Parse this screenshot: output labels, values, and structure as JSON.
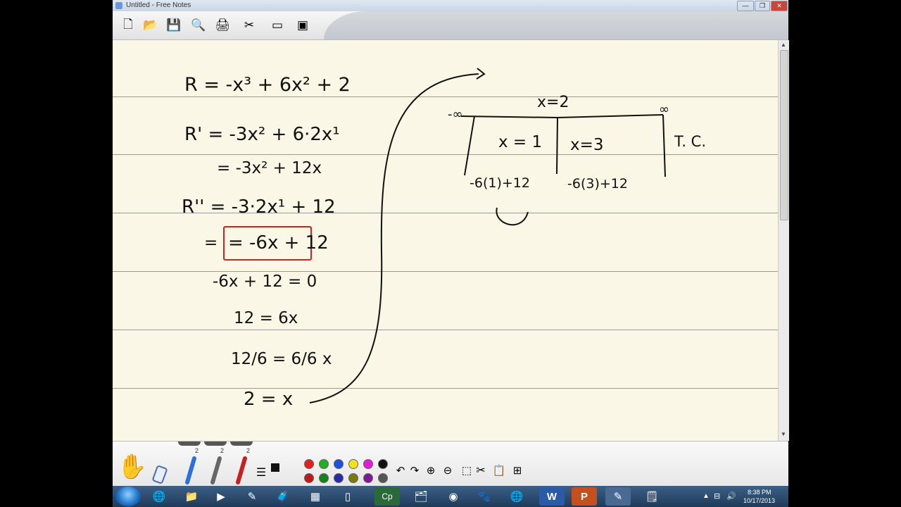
{
  "window": {
    "title": "Untitled - Free Notes",
    "controls": [
      "—",
      "❐",
      "✕"
    ]
  },
  "toolbar": {
    "buttons": [
      {
        "name": "new-file",
        "glyph": "🗋"
      },
      {
        "name": "open-folder",
        "glyph": "📂"
      },
      {
        "name": "save",
        "glyph": "💾"
      },
      {
        "name": "preview",
        "glyph": "🔍"
      },
      {
        "name": "print",
        "glyph": "🖨"
      },
      {
        "name": "capture",
        "glyph": "✂"
      },
      {
        "name": "window",
        "glyph": "▭"
      },
      {
        "name": "export",
        "glyph": "▣"
      }
    ]
  },
  "notes": {
    "left_column": [
      "R = -x³ + 6x² + 2",
      "R' = -3x² + 6·2x¹",
      "= -3x² + 12x",
      "R'' = -3·2x¹ + 12",
      "= -6x + 12",
      "-6x + 12 = 0",
      "12 = 6x",
      "12/6 = 6/6 x",
      "2 = x"
    ],
    "right_section": {
      "critical_point": "x=2",
      "neg_infinity": "-∞",
      "pos_infinity": "∞",
      "intervals": [
        {
          "test": "x = 1",
          "value": "-6(1)+12"
        },
        {
          "test": "x=3",
          "value": "-6(3)+12"
        }
      ],
      "label": "T. C."
    }
  },
  "pen_panel": {
    "pen_numbers": [
      "2",
      "2",
      "2"
    ],
    "colors": {
      "row1": [
        "#e3201b",
        "#20b020",
        "#1d4fe0",
        "#f2e21a",
        "#e21ad9",
        "#111111"
      ],
      "row2": [
        "#c01818",
        "#188018",
        "#2a2aa8",
        "#7a7a10",
        "#7a1a9a",
        "#555555"
      ]
    }
  },
  "taskbar": {
    "apps": [
      "🌐",
      "📁",
      "▶",
      "✎",
      "🧳",
      "▦",
      "▯",
      "Cp",
      "🗂",
      "◉",
      "🐾",
      "🌐",
      "W",
      "P",
      "✎",
      "🗒"
    ],
    "time": "8:38 PM",
    "date": "10/17/2013"
  }
}
